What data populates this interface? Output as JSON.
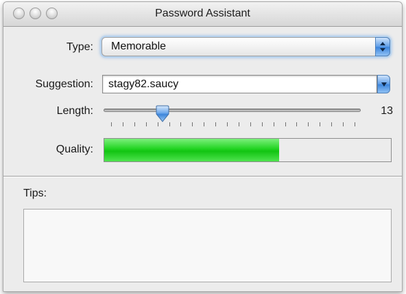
{
  "window": {
    "title": "Password Assistant",
    "buttons": [
      "close",
      "minimize",
      "zoom"
    ]
  },
  "type": {
    "label": "Type:",
    "value": "Memorable",
    "icon": "up-down-arrows-icon"
  },
  "suggestion": {
    "label": "Suggestion:",
    "value": "stagy82.saucy",
    "icon": "chevron-down-icon"
  },
  "length": {
    "label": "Length:",
    "value": "13",
    "position_fraction": 0.23
  },
  "quality": {
    "label": "Quality:",
    "level_fraction": 0.61,
    "color": "#1fd11f"
  },
  "tips": {
    "label": "Tips:",
    "text": ""
  }
}
